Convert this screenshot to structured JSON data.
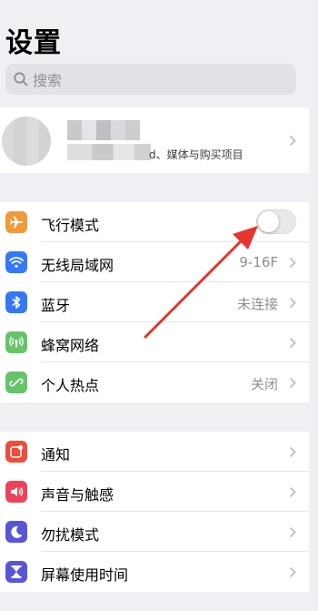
{
  "header": {
    "title": "设置"
  },
  "search": {
    "placeholder": "搜索"
  },
  "profile": {
    "subtitle": "d、媒体与购买项目"
  },
  "group1": [
    {
      "label": "飞行模式",
      "icon": "airplane-icon",
      "color": "#f09a37",
      "toggle": false
    },
    {
      "label": "无线局域网",
      "icon": "wifi-icon",
      "color": "#3478f6",
      "value": "9-16F"
    },
    {
      "label": "蓝牙",
      "icon": "bluetooth-icon",
      "color": "#3478f6",
      "value": "未连接"
    },
    {
      "label": "蜂窝网络",
      "icon": "cellular-icon",
      "color": "#65c466",
      "value": ""
    },
    {
      "label": "个人热点",
      "icon": "hotspot-icon",
      "color": "#65c466",
      "value": "关闭"
    }
  ],
  "group2": [
    {
      "label": "通知",
      "icon": "notifications-icon",
      "color": "#eb4e3d"
    },
    {
      "label": "声音与触感",
      "icon": "sound-icon",
      "color": "#eb445a"
    },
    {
      "label": "勿扰模式",
      "icon": "moon-icon",
      "color": "#5856d6"
    },
    {
      "label": "屏幕使用时间",
      "icon": "hourglass-icon",
      "color": "#5856d6"
    }
  ],
  "annotation": {
    "color": "#e8332e"
  }
}
